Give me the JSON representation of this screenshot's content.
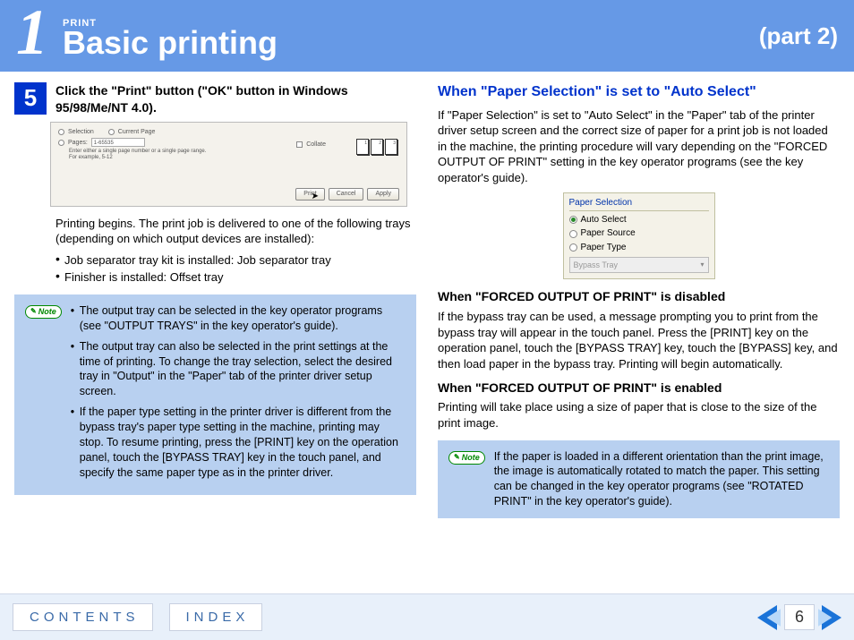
{
  "header": {
    "chapter_number": "1",
    "category": "PRINT",
    "title": "Basic printing",
    "part": "(part 2)"
  },
  "step": {
    "number": "5",
    "title": "Click the \"Print\" button (\"OK\" button in Windows 95/98/Me/NT 4.0).",
    "dialog": {
      "opt_selection": "Selection",
      "opt_current": "Current Page",
      "opt_pages": "Pages:",
      "pages_value": "1-65535",
      "hint": "Enter either a single page number or a single page range. For example, 5-12",
      "opt_collate": "Collate",
      "btn_print": "Print",
      "btn_cancel": "Cancel",
      "btn_apply": "Apply"
    },
    "body": "Printing begins. The print job is delivered to one of the following trays (depending on which output devices are installed):",
    "bullets": [
      "Job separator tray kit is installed: Job separator tray",
      "Finisher is installed: Offset tray"
    ]
  },
  "note1": {
    "label": "Note",
    "items": [
      "The output tray can be selected in the key operator programs (see \"OUTPUT TRAYS\" in the key operator's guide).",
      "The output tray can also be selected in the print settings at the time of printing. To change the tray selection, select the desired tray in \"Output\" in the \"Paper\" tab of the printer driver setup screen.",
      "If the paper type setting in the printer driver is different from the bypass tray's paper type setting in the machine, printing may stop. To resume printing, press the [PRINT] key on the operation panel, touch the [BYPASS TRAY] key in the touch panel, and specify the same paper type as in the printer driver."
    ]
  },
  "right": {
    "heading": "When \"Paper Selection\" is set to \"Auto Select\"",
    "intro": "If \"Paper Selection\" is set to \"Auto Select\" in the \"Paper\" tab of the printer driver setup screen and the correct size of paper for a print job is not loaded in the machine, the printing procedure will vary depending on the \"FORCED OUTPUT OF PRINT\" setting in the key operator programs (see the key operator's guide).",
    "paper_select": {
      "group_title": "Paper Selection",
      "opt1": "Auto Select",
      "opt2": "Paper Source",
      "opt3": "Paper Type",
      "dropdown": "Bypass Tray"
    },
    "sub1_h": "When \"FORCED OUTPUT OF PRINT\" is disabled",
    "sub1_p": "If the bypass tray can be used, a message prompting you to print from the bypass tray will appear in the touch panel. Press the [PRINT] key on the operation panel, touch the [BYPASS TRAY] key, touch the [BYPASS] key, and then load paper in the bypass tray. Printing will begin automatically.",
    "sub2_h": "When \"FORCED OUTPUT OF PRINT\" is enabled",
    "sub2_p": "Printing will take place using a size of paper that is close to the size of the print image."
  },
  "note2": {
    "label": "Note",
    "text": "If the paper is loaded in a different orientation than the print image, the image is automatically rotated to match the paper. This setting can be changed in the key operator programs (see \"ROTATED PRINT\" in the key operator's guide)."
  },
  "footer": {
    "contents": "CONTENTS",
    "index": "INDEX",
    "page": "6"
  }
}
